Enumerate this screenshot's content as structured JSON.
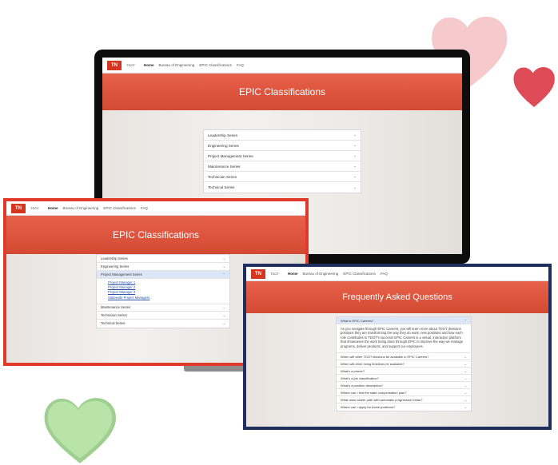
{
  "colors": {
    "brand_red": "#d6361f",
    "hero_red": "#e05a43",
    "accent_blue": "#1e2f5e",
    "frame_red": "#e03a2a",
    "heart_pink": "#f6c9cc",
    "heart_red": "#de4a55",
    "heart_green": "#b8e3a9"
  },
  "site": {
    "logo": "TN",
    "logo_sub": "TDOT",
    "nav": [
      "Home",
      "Bureau of Engineering",
      "EPIC Classifications",
      "FAQ"
    ]
  },
  "monitor": {
    "title": "EPIC Classifications",
    "items": [
      "Leadership Series",
      "Engineering Series",
      "Project Management Series",
      "Maintenance Series",
      "Technician Series",
      "Technical Series"
    ]
  },
  "left_shot": {
    "title": "EPIC Classifications",
    "items_before": [
      "Leadership Series",
      "Engineering Series"
    ],
    "open_item": "Project Management Series",
    "sub_links": [
      "Project Manager 1",
      "Project Manager 2",
      "Project Manager 3",
      "Statewide Project Managers"
    ],
    "items_after": [
      "Maintenance Series",
      "Technician Series",
      "Technical Series"
    ]
  },
  "right_shot": {
    "title": "Frequently Asked Questions",
    "open_question": "What is EPIC Careers?",
    "answer": "As you navigate through EPIC Careers, you will learn more about TDOT divisions positions they are transforming the way they do work, new positions and how each role contributes to TDOT's success! EPIC Careers is a virtual, interactive platform that showcases the work being done through EPIC to improve the way we manage programs, deliver products, and support our employees.",
    "questions": [
      "When will other TDOT divisions be available in EPIC Careers?",
      "When will other hiring timelines be available?",
      "What's a primer?",
      "What's a job classification?",
      "What's a position description?",
      "Where can I find the state compensation plan?",
      "What does career path with automatic progression mean?",
      "Where can I apply for these positions?"
    ]
  }
}
